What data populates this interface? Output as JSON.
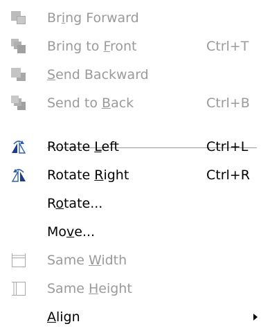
{
  "menu": {
    "items": [
      {
        "pre": "Br",
        "mn": "i",
        "post": "ng Forward",
        "shortcut": "",
        "icon": "bring-forward-icon"
      },
      {
        "pre": "Bring to ",
        "mn": "F",
        "post": "ront",
        "shortcut": "Ctrl+T",
        "icon": "bring-to-front-icon"
      },
      {
        "pre": "",
        "mn": "S",
        "post": "end Backward",
        "shortcut": "",
        "icon": "send-backward-icon"
      },
      {
        "pre": "Send to ",
        "mn": "B",
        "post": "ack",
        "shortcut": "Ctrl+B",
        "icon": "send-to-back-icon"
      },
      {
        "pre": "Rotate ",
        "mn": "L",
        "post": "eft",
        "shortcut": "Ctrl+L",
        "icon": "rotate-left-icon"
      },
      {
        "pre": "Rotate ",
        "mn": "R",
        "post": "ight",
        "shortcut": "Ctrl+R",
        "icon": "rotate-right-icon"
      },
      {
        "pre": "R",
        "mn": "o",
        "post": "tate...",
        "shortcut": ""
      },
      {
        "pre": "Mo",
        "mn": "v",
        "post": "e...",
        "shortcut": ""
      },
      {
        "pre": "Same ",
        "mn": "W",
        "post": "idth",
        "shortcut": "",
        "icon": "same-width-icon"
      },
      {
        "pre": "Same ",
        "mn": "H",
        "post": "eight",
        "shortcut": "",
        "icon": "same-height-icon"
      },
      {
        "pre": "",
        "mn": "A",
        "post": "lign",
        "shortcut": "",
        "submenu": true
      }
    ]
  }
}
